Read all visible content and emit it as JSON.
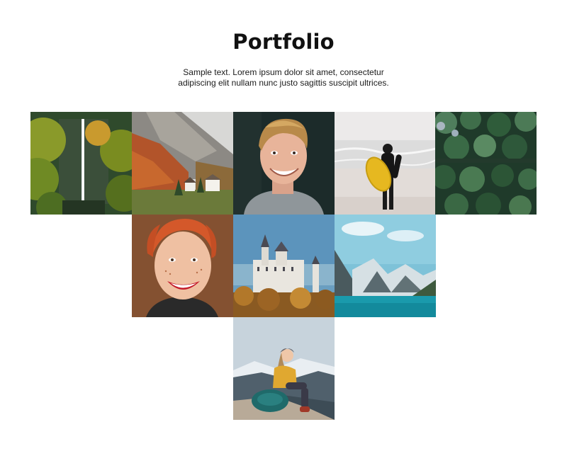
{
  "section": {
    "title": "Portfolio",
    "subtitle": "Sample text. Lorem ipsum dolor sit amet, consectetur adipiscing elit nullam nunc justo sagittis suscipit ultrices."
  },
  "gallery": {
    "images": [
      {
        "subject": "waterfall-forest"
      },
      {
        "subject": "mountain-village"
      },
      {
        "subject": "smiling-man"
      },
      {
        "subject": "surfer-beach"
      },
      {
        "subject": "pine-forest-aerial"
      },
      {
        "subject": "red-haired-woman"
      },
      {
        "subject": "castle"
      },
      {
        "subject": "mountain-lake"
      },
      {
        "subject": "hiker-mountains"
      }
    ]
  }
}
